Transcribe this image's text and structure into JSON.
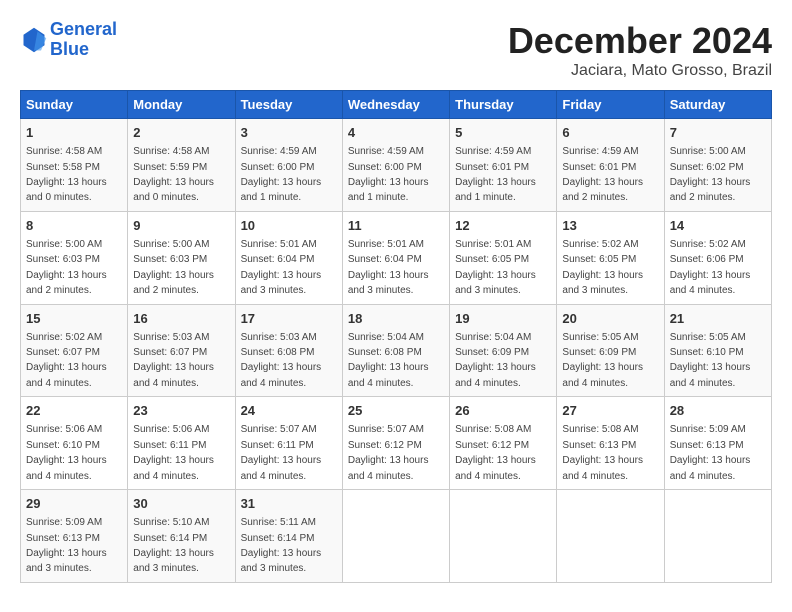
{
  "header": {
    "logo_line1": "General",
    "logo_line2": "Blue",
    "month_title": "December 2024",
    "subtitle": "Jaciara, Mato Grosso, Brazil"
  },
  "weekdays": [
    "Sunday",
    "Monday",
    "Tuesday",
    "Wednesday",
    "Thursday",
    "Friday",
    "Saturday"
  ],
  "weeks": [
    [
      {
        "day": "1",
        "sunrise": "4:58 AM",
        "sunset": "5:58 PM",
        "daylight": "13 hours and 0 minutes."
      },
      {
        "day": "2",
        "sunrise": "4:58 AM",
        "sunset": "5:59 PM",
        "daylight": "13 hours and 0 minutes."
      },
      {
        "day": "3",
        "sunrise": "4:59 AM",
        "sunset": "6:00 PM",
        "daylight": "13 hours and 1 minute."
      },
      {
        "day": "4",
        "sunrise": "4:59 AM",
        "sunset": "6:00 PM",
        "daylight": "13 hours and 1 minute."
      },
      {
        "day": "5",
        "sunrise": "4:59 AM",
        "sunset": "6:01 PM",
        "daylight": "13 hours and 1 minute."
      },
      {
        "day": "6",
        "sunrise": "4:59 AM",
        "sunset": "6:01 PM",
        "daylight": "13 hours and 2 minutes."
      },
      {
        "day": "7",
        "sunrise": "5:00 AM",
        "sunset": "6:02 PM",
        "daylight": "13 hours and 2 minutes."
      }
    ],
    [
      {
        "day": "8",
        "sunrise": "5:00 AM",
        "sunset": "6:03 PM",
        "daylight": "13 hours and 2 minutes."
      },
      {
        "day": "9",
        "sunrise": "5:00 AM",
        "sunset": "6:03 PM",
        "daylight": "13 hours and 2 minutes."
      },
      {
        "day": "10",
        "sunrise": "5:01 AM",
        "sunset": "6:04 PM",
        "daylight": "13 hours and 3 minutes."
      },
      {
        "day": "11",
        "sunrise": "5:01 AM",
        "sunset": "6:04 PM",
        "daylight": "13 hours and 3 minutes."
      },
      {
        "day": "12",
        "sunrise": "5:01 AM",
        "sunset": "6:05 PM",
        "daylight": "13 hours and 3 minutes."
      },
      {
        "day": "13",
        "sunrise": "5:02 AM",
        "sunset": "6:05 PM",
        "daylight": "13 hours and 3 minutes."
      },
      {
        "day": "14",
        "sunrise": "5:02 AM",
        "sunset": "6:06 PM",
        "daylight": "13 hours and 4 minutes."
      }
    ],
    [
      {
        "day": "15",
        "sunrise": "5:02 AM",
        "sunset": "6:07 PM",
        "daylight": "13 hours and 4 minutes."
      },
      {
        "day": "16",
        "sunrise": "5:03 AM",
        "sunset": "6:07 PM",
        "daylight": "13 hours and 4 minutes."
      },
      {
        "day": "17",
        "sunrise": "5:03 AM",
        "sunset": "6:08 PM",
        "daylight": "13 hours and 4 minutes."
      },
      {
        "day": "18",
        "sunrise": "5:04 AM",
        "sunset": "6:08 PM",
        "daylight": "13 hours and 4 minutes."
      },
      {
        "day": "19",
        "sunrise": "5:04 AM",
        "sunset": "6:09 PM",
        "daylight": "13 hours and 4 minutes."
      },
      {
        "day": "20",
        "sunrise": "5:05 AM",
        "sunset": "6:09 PM",
        "daylight": "13 hours and 4 minutes."
      },
      {
        "day": "21",
        "sunrise": "5:05 AM",
        "sunset": "6:10 PM",
        "daylight": "13 hours and 4 minutes."
      }
    ],
    [
      {
        "day": "22",
        "sunrise": "5:06 AM",
        "sunset": "6:10 PM",
        "daylight": "13 hours and 4 minutes."
      },
      {
        "day": "23",
        "sunrise": "5:06 AM",
        "sunset": "6:11 PM",
        "daylight": "13 hours and 4 minutes."
      },
      {
        "day": "24",
        "sunrise": "5:07 AM",
        "sunset": "6:11 PM",
        "daylight": "13 hours and 4 minutes."
      },
      {
        "day": "25",
        "sunrise": "5:07 AM",
        "sunset": "6:12 PM",
        "daylight": "13 hours and 4 minutes."
      },
      {
        "day": "26",
        "sunrise": "5:08 AM",
        "sunset": "6:12 PM",
        "daylight": "13 hours and 4 minutes."
      },
      {
        "day": "27",
        "sunrise": "5:08 AM",
        "sunset": "6:13 PM",
        "daylight": "13 hours and 4 minutes."
      },
      {
        "day": "28",
        "sunrise": "5:09 AM",
        "sunset": "6:13 PM",
        "daylight": "13 hours and 4 minutes."
      }
    ],
    [
      {
        "day": "29",
        "sunrise": "5:09 AM",
        "sunset": "6:13 PM",
        "daylight": "13 hours and 3 minutes."
      },
      {
        "day": "30",
        "sunrise": "5:10 AM",
        "sunset": "6:14 PM",
        "daylight": "13 hours and 3 minutes."
      },
      {
        "day": "31",
        "sunrise": "5:11 AM",
        "sunset": "6:14 PM",
        "daylight": "13 hours and 3 minutes."
      },
      null,
      null,
      null,
      null
    ]
  ]
}
